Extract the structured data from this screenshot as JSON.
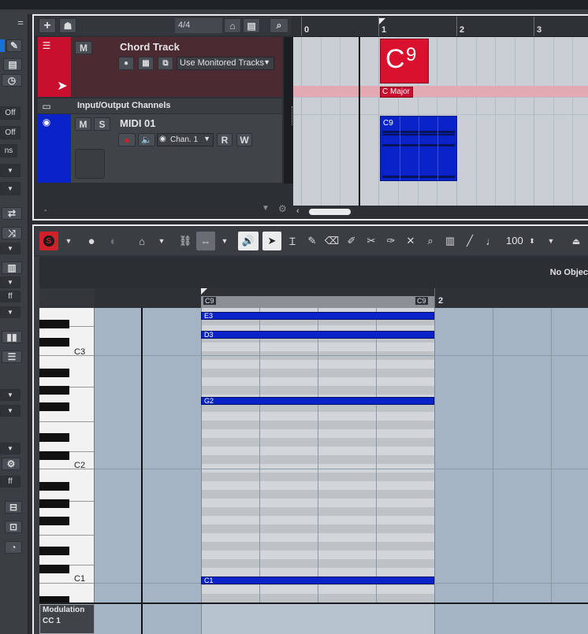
{
  "project_toolbar": {
    "add_track": "+",
    "track_count": "4/4"
  },
  "tracks": {
    "chord": {
      "name": "Chord Track",
      "mute": "M",
      "mode": "Use Monitored Tracks"
    },
    "folder": {
      "name": "Input/Output Channels"
    },
    "midi": {
      "name": "MIDI 01",
      "mute": "M",
      "solo": "S",
      "channel": "Chan. 1",
      "read": "R",
      "write": "W"
    }
  },
  "ruler": {
    "bars": [
      "0",
      "1",
      "2",
      "3"
    ]
  },
  "chord_event": {
    "symbol": "C",
    "extension": "9",
    "scale": "C Major"
  },
  "midi_part": {
    "label": "C9"
  },
  "inspector": {
    "values": [
      "Off",
      "Off",
      "ns",
      "ff",
      "ff"
    ]
  },
  "editor": {
    "velocity": "100",
    "no_object": "No Objec",
    "ruler_markers": [
      "C9",
      "C9",
      "2"
    ],
    "keyboard_labels": [
      "C3",
      "C2",
      "C1"
    ],
    "notes": [
      "E3",
      "D3",
      "G2",
      "C1"
    ],
    "controller_lane": {
      "name": "Modulation",
      "cc": "CC 1"
    }
  },
  "colors": {
    "chord_track": "#c8102e",
    "midi_track": "#0a23c8",
    "note": "#0a23c8",
    "record": "#d0202a"
  }
}
